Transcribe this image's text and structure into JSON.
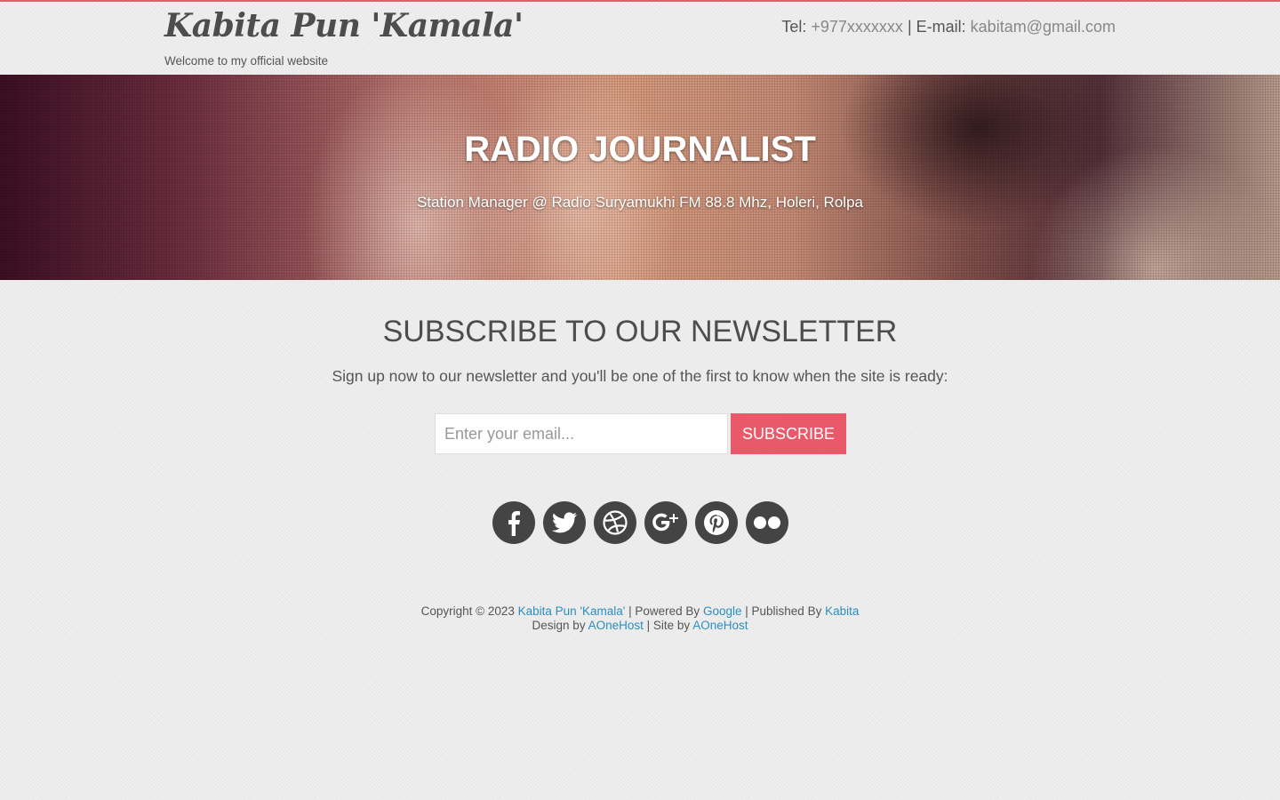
{
  "header": {
    "site_title": "Kabita Pun 'Kamala'",
    "tagline": "Welcome to my official website",
    "tel_label": "Tel:",
    "tel_value": "+977xxxxxxx",
    "separator": "|",
    "email_label": "E-mail:",
    "email_value": "kabitam@gmail.com"
  },
  "hero": {
    "title": "RADIO JOURNALIST",
    "subtitle": "Station Manager @ Radio Suryamukhi FM 88.8 Mhz, Holeri, Rolpa"
  },
  "newsletter": {
    "title": "SUBSCRIBE TO OUR NEWSLETTER",
    "text": "Sign up now to our newsletter and you'll be one of the first to know when the site is ready:",
    "email_placeholder": "Enter your email...",
    "email_value": "",
    "button_label": "SUBSCRIBE"
  },
  "social": [
    {
      "icon": "facebook-icon"
    },
    {
      "icon": "twitter-icon"
    },
    {
      "icon": "dribbble-icon"
    },
    {
      "icon": "google-plus-icon"
    },
    {
      "icon": "pinterest-icon"
    },
    {
      "icon": "flickr-icon"
    }
  ],
  "footer": {
    "copyright": "Copyright © 2023",
    "site_link": "Kabita Pun 'Kamala'",
    "powered_by": "| Powered By",
    "google_link": "Google",
    "published_by": "| Published By",
    "kabita_link": "Kabita",
    "design_by": "Design by",
    "design_link": "AOneHost",
    "site_by": "| Site by",
    "site_by_link": "AOneHost"
  },
  "colors": {
    "accent": "#e85a6a",
    "link": "#2a8fc0",
    "icon_bg": "#444444",
    "text": "#555555"
  }
}
